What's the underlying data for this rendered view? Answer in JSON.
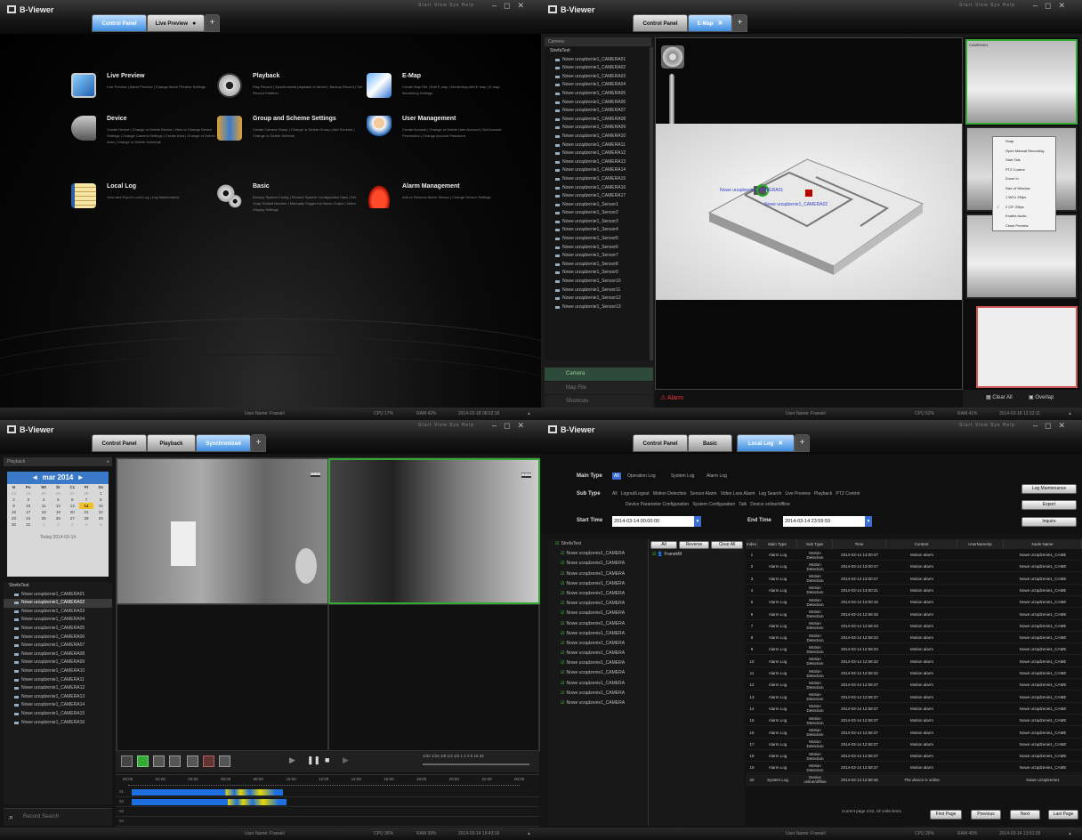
{
  "app_title": "B-Viewer",
  "menus": "Start   View   Sys   Help",
  "window_controls": [
    "–",
    "◻",
    "✕"
  ],
  "q1": {
    "tabs": [
      "Control Panel",
      "Live Preview"
    ],
    "modules": [
      {
        "title": "Live Preview",
        "desc": "Live Preview | Alarm Preview | Change Alarm Preview Settings"
      },
      {
        "title": "Playback",
        "desc": "Play Record | Synchronized playback of device | Backup Record | Set Record Partition"
      },
      {
        "title": "E-Map",
        "desc": "Create Map File | Edit E-map | Monitoring with E-map | E-map Monitoring Settings"
      },
      {
        "title": "Device",
        "desc": "Create Device | Change or Delete Device | View or Change Device Settings | Change Camera Settings | Create Area | Change or Delete Area | Change or Delete Schedule"
      },
      {
        "title": "Group and Scheme Settings",
        "desc": "Create Camera Group | Change or Delete Group | Add Scheme | Change or Delete Scheme"
      },
      {
        "title": "User Management",
        "desc": "Create Account | Change or Delete User Account | Set Account Permission | Change Account Password"
      },
      {
        "title": "Local Log",
        "desc": "View and Export Local Log | Log Maintenance"
      },
      {
        "title": "Basic",
        "desc": "Backup System Config | Restore System Configuration Data | Set Snap Default Number | Manually Trigger the Alarm Output | Video Display Settings"
      },
      {
        "title": "Alarm Management",
        "desc": "Add or Remove Alarm Sensor | Change Sensor Settings"
      }
    ],
    "status": {
      "user": "User Name: Franekl",
      "cpu": "CPU 17%",
      "ram": "RAM 42%",
      "time": "2014-03-18 08:02:16"
    }
  },
  "q2": {
    "tabs": [
      "Control Panel",
      "E-Map"
    ],
    "tree_header": "Camera",
    "tree_root": "StrefaTest",
    "camera_label": "Nowe urządzenie1_CAMERA",
    "camera_count": 17,
    "sensor_label": "Nowe urządzenie1_Sensor",
    "sensor_count": 13,
    "side_tabs": [
      "Camera",
      "Map File",
      "Shortcuts"
    ],
    "map_labels": [
      "Nowe urządzenie1_CAMERA01",
      "Nowe urządzenie1_CAMERA02"
    ],
    "alarm_label": "Alarm",
    "clear_all": "Clear All",
    "overlap": "Overlap",
    "thumb_label": "CAMERA01",
    "context_menu": [
      "Snap",
      "Open Manual Recording",
      "Start Talk",
      "PTZ Control",
      "Zoom In",
      "Size of Window",
      "1 WD1 25fps",
      "2 CIF 25fps",
      "Enable Audio",
      "Close Preview"
    ],
    "status": {
      "user": "User Name: Franekl",
      "cpu": "CPU 52%",
      "ram": "RAM 41%",
      "time": "2014-03-18 12:32:11"
    }
  },
  "q3": {
    "tabs": [
      "Control Panel",
      "Playback",
      "Synchronized"
    ],
    "panel_title": "Playback",
    "calendar": {
      "month": "mar 2014",
      "days_header": [
        "N",
        "Pn",
        "Wt",
        "Śr",
        "Cz",
        "Pt",
        "So"
      ],
      "weeks": [
        [
          "23",
          "24",
          "25",
          "26",
          "27",
          "28",
          "1"
        ],
        [
          "2",
          "3",
          "4",
          "5",
          "6",
          "7",
          "8"
        ],
        [
          "9",
          "10",
          "11",
          "12",
          "13",
          "14",
          "15"
        ],
        [
          "16",
          "17",
          "18",
          "19",
          "20",
          "21",
          "22"
        ],
        [
          "23",
          "24",
          "25",
          "26",
          "27",
          "28",
          "29"
        ],
        [
          "30",
          "31",
          "1",
          "2",
          "3",
          "4",
          "5"
        ]
      ],
      "today": "Today:2014-03-14"
    },
    "tree_root": "StrefaTest",
    "cameras": [
      "Nowe urządzenie1_CAMERA01",
      "Nowe urządzenie1_CAMERA02",
      "Nowe urządzenie1_CAMERA03",
      "Nowe urządzenie1_CAMERA04",
      "Nowe urządzenie1_CAMERA05",
      "Nowe urządzenie1_CAMERA06",
      "Nowe urządzenie1_CAMERA07",
      "Nowe urządzenie1_CAMERA08",
      "Nowe urządzenie1_CAMERA09",
      "Nowe urządzenie1_CAMERA10",
      "Nowe urządzenie1_CAMERA11",
      "Nowe urządzenie1_CAMERA12",
      "Nowe urządzenie1_CAMERA13",
      "Nowe urządzenie1_CAMERA14",
      "Nowe urządzenie1_CAMERA15",
      "Nowe urządzenie1_CAMERA16"
    ],
    "search_placeholder": "Record Search",
    "timeline_times": [
      "00:00",
      "02:00",
      "04:00",
      "06:00",
      "08:00",
      "10:00",
      "12:00",
      "14:00",
      "16:00",
      "18:00",
      "20:00",
      "22:00",
      "00:00"
    ],
    "time_info": "1/32 1/16 1/8 1/4 1/2  1  2  4  8  16  32",
    "track_labels": [
      "01",
      "02",
      "03",
      "04"
    ],
    "status": {
      "user": "User Name: Franekl",
      "cpu": "CPU 36%",
      "ram": "RAM 39%",
      "time": "2014-03-14 16:43:16"
    }
  },
  "q4": {
    "tabs": [
      "Control Panel",
      "Basic",
      "Local Log"
    ],
    "main_type_label": "Main Type",
    "main_types": [
      "All",
      "Operation Log",
      "System Log",
      "Alarm Log"
    ],
    "sub_type_label": "Sub Type",
    "sub_types": "All   Logout/Logout   Motion Detection   Sensor Alarm   Video Loss Alarm   Log Search   Live Preview   Playback   PTZ Control",
    "sub_types_2": "Device Parameter Configuration   System Configuration   Talk   Device online/offline",
    "start_label": "Start Time",
    "start_value": "2014-03-14 00:00:00",
    "end_label": "End Time",
    "end_value": "2014-03-14 23:59:59",
    "buttons": [
      "Log Maintenance",
      "Export",
      "Inquire"
    ],
    "tree_root": "StrefaTest",
    "tree_item": "Nowe urządzenie1_CAMERA",
    "tree_count": 16,
    "filter_buttons": [
      "All",
      "Reverse",
      "Clear All"
    ],
    "user": "FranekM",
    "columns": [
      "Index",
      "Main Type",
      "Sub Type",
      "Time",
      "Content",
      "UserName/Ip",
      "Node Name"
    ],
    "rows": [
      [
        "1",
        "Alarm Log",
        "Motion\nDetection",
        "2014-03-14 13:00:47",
        "Motion alarm",
        "",
        "Nowe urządzenie1_CAME"
      ],
      [
        "2",
        "Alarm Log",
        "Motion\nDetection",
        "2014-03-14 13:00:47",
        "Motion alarm",
        "",
        "Nowe urządzenie1_CAME"
      ],
      [
        "3",
        "Alarm Log",
        "Motion\nDetection",
        "2014-03-14 13:00:47",
        "Motion alarm",
        "",
        "Nowe urządzenie1_CAME"
      ],
      [
        "4",
        "Alarm Log",
        "Motion\nDetection",
        "2014-03-14 13:00:31",
        "Motion alarm",
        "",
        "Nowe urządzenie1_CAME"
      ],
      [
        "5",
        "Alarm Log",
        "Motion\nDetection",
        "2014-03-14 13:00:16",
        "Motion alarm",
        "",
        "Nowe urządzenie1_CAME"
      ],
      [
        "6",
        "Alarm Log",
        "Motion\nDetection",
        "2014-03-14 12:58:45",
        "Motion alarm",
        "",
        "Nowe urządzenie1_CAME"
      ],
      [
        "7",
        "Alarm Log",
        "Motion\nDetection",
        "2014-03-14 12:58:43",
        "Motion alarm",
        "",
        "Nowe urządzenie1_CAME"
      ],
      [
        "8",
        "Alarm Log",
        "Motion\nDetection",
        "2014-03-14 12:58:33",
        "Motion alarm",
        "",
        "Nowe urządzenie1_CAME"
      ],
      [
        "9",
        "Alarm Log",
        "Motion\nDetection",
        "2014-03-14 12:58:33",
        "Motion alarm",
        "",
        "Nowe urządzenie1_CAME"
      ],
      [
        "10",
        "Alarm Log",
        "Motion\nDetection",
        "2014-03-14 12:58:32",
        "Motion alarm",
        "",
        "Nowe urządzenie1_CAME"
      ],
      [
        "11",
        "Alarm Log",
        "Motion\nDetection",
        "2014-03-14 12:58:32",
        "Motion alarm",
        "",
        "Nowe urządzenie1_CAME"
      ],
      [
        "12",
        "Alarm Log",
        "Motion\nDetection",
        "2014-03-14 12:58:37",
        "Motion alarm",
        "",
        "Nowe urządzenie1_CAME"
      ],
      [
        "13",
        "Alarm Log",
        "Motion\nDetection",
        "2014-03-14 12:58:37",
        "Motion alarm",
        "",
        "Nowe urządzenie1_CAME"
      ],
      [
        "14",
        "Alarm Log",
        "Motion\nDetection",
        "2014-03-14 12:58:37",
        "Motion alarm",
        "",
        "Nowe urządzenie1_CAME"
      ],
      [
        "15",
        "Alarm Log",
        "Motion\nDetection",
        "2014-03-14 12:58:37",
        "Motion alarm",
        "",
        "Nowe urządzenie1_CAME"
      ],
      [
        "16",
        "Alarm Log",
        "Motion\nDetection",
        "2014-03-14 12:58:37",
        "Motion alarm",
        "",
        "Nowe urządzenie1_CAME"
      ],
      [
        "17",
        "Alarm Log",
        "Motion\nDetection",
        "2014-03-14 12:58:37",
        "Motion alarm",
        "",
        "Nowe urządzenie1_CAME"
      ],
      [
        "18",
        "Alarm Log",
        "Motion\nDetection",
        "2014-03-14 12:58:37",
        "Motion alarm",
        "",
        "Nowe urządzenie1_CAME"
      ],
      [
        "19",
        "Alarm Log",
        "Motion\nDetection",
        "2014-03-14 12:58:37",
        "Motion alarm",
        "",
        "Nowe urządzenie1_CAME"
      ],
      [
        "20",
        "System Log",
        "Device\nonline/offline",
        "2014-03-14 12:58:36",
        "The device is online",
        "",
        "Nowe urządzenie1"
      ]
    ],
    "page_info": "Current page 1/22, All 1406 items",
    "pager": [
      "First Page",
      "Previous",
      "Next",
      "Last Page"
    ],
    "status": {
      "user": "User Name: Franekl",
      "cpu": "CPU 26%",
      "ram": "RAM 45%",
      "time": "2014-03-14 13:01:26"
    }
  }
}
